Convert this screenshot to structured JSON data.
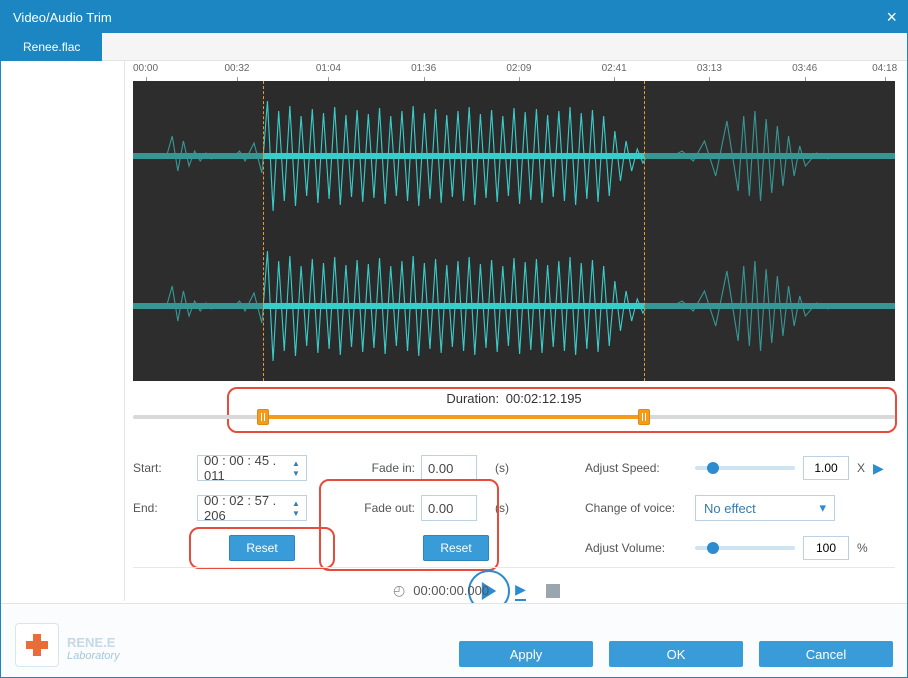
{
  "window": {
    "title": "Video/Audio Trim"
  },
  "tab": {
    "label": "Renee.flac"
  },
  "ruler": [
    "00:00",
    "00:32",
    "01:04",
    "01:36",
    "02:09",
    "02:41",
    "03:13",
    "03:46",
    "04:18"
  ],
  "selection": {
    "start_pct": 17,
    "end_pct": 67
  },
  "duration": {
    "label": "Duration:",
    "value": "00:02:12.195"
  },
  "start": {
    "label": "Start:",
    "value": "00 : 00 : 45 . 011"
  },
  "end": {
    "label": "End:",
    "value": "00 : 02 : 57 . 206"
  },
  "fade_in": {
    "label": "Fade in:",
    "value": "0.00",
    "unit": "(s)"
  },
  "fade_out": {
    "label": "Fade out:",
    "value": "0.00",
    "unit": "(s)"
  },
  "reset": {
    "label": "Reset"
  },
  "speed": {
    "label": "Adjust Speed:",
    "value": "1.00",
    "suffix": "X",
    "knob_pct": 12
  },
  "voice": {
    "label": "Change of voice:",
    "value": "No effect"
  },
  "volume": {
    "label": "Adjust Volume:",
    "value": "100",
    "suffix": "%",
    "knob_pct": 12
  },
  "playbar": {
    "time": "00:00:00.000"
  },
  "logo": {
    "name": "RENE.E",
    "sub": "Laboratory"
  },
  "buttons": {
    "apply": "Apply",
    "ok": "OK",
    "cancel": "Cancel"
  }
}
